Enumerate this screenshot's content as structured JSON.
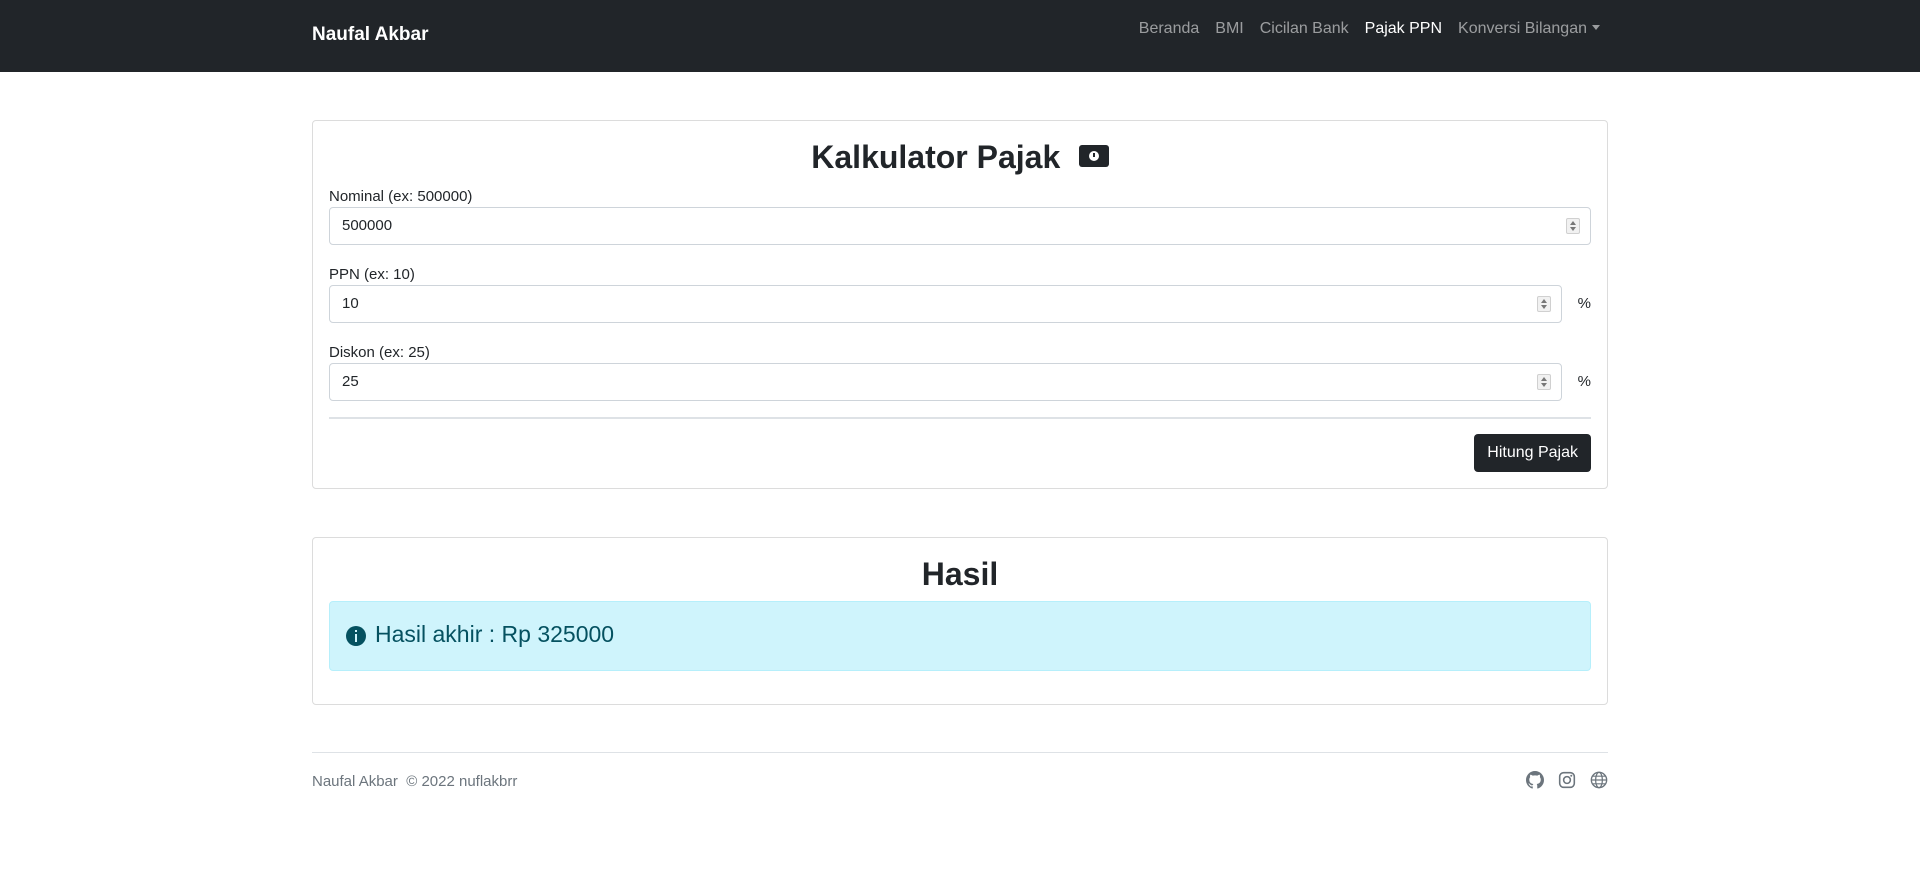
{
  "navbar": {
    "brand": "Naufal Akbar",
    "links": [
      "Beranda",
      "BMI",
      "Cicilan Bank",
      "Pajak PPN",
      "Konversi Bilangan"
    ],
    "active": "Pajak PPN"
  },
  "calculator": {
    "title": "Kalkulator Pajak",
    "info_icon": "info-badge-icon",
    "nominal": {
      "label": "Nominal (ex: 500000)",
      "value": "500000"
    },
    "ppn": {
      "label": "PPN (ex: 10)",
      "value": "10",
      "unit": "%"
    },
    "diskon": {
      "label": "Diskon (ex: 25)",
      "value": "25",
      "unit": "%"
    },
    "button": "Hitung Pajak"
  },
  "result": {
    "title": "Hasil",
    "text": "Hasil akhir : Rp 325000",
    "icon": "info-circle-icon"
  },
  "footer": {
    "text": "Naufal Akbar  © 2022 nuflakbrr",
    "icons": [
      "github-icon",
      "instagram-icon",
      "globe-icon"
    ]
  },
  "colors": {
    "navbar_bg": "#212529",
    "alert_bg": "#cff4fc",
    "alert_text": "#055160"
  }
}
